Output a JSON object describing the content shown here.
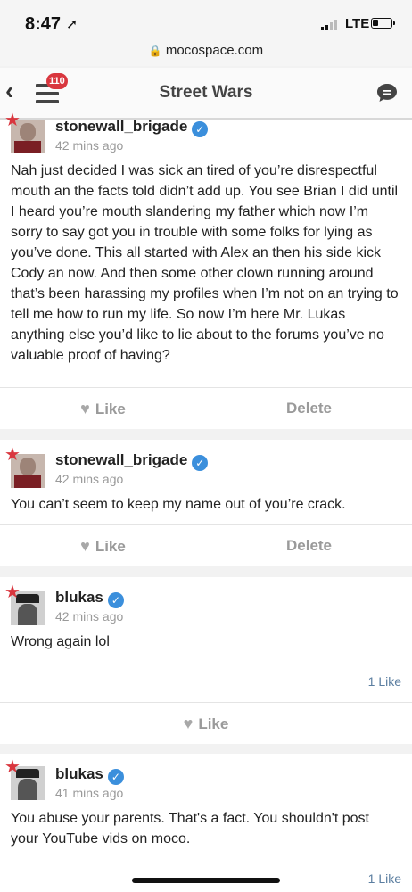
{
  "status": {
    "time": "8:47",
    "network": "LTE"
  },
  "browser": {
    "url": "mocospace.com"
  },
  "header": {
    "title": "Street Wars",
    "badge_count": "110"
  },
  "posts": [
    {
      "username": "stonewall_brigade",
      "time": "42 mins ago",
      "text": "Nah just decided I was sick an tired of you’re disrespectful mouth an the facts told didn’t add up. You see Brian I did until I heard you’re mouth slandering my father which now I’m sorry to say got you in trouble with some folks for lying as you’ve done. This all started with Alex an then his side kick Cody an now. And then some other clown running around that’s been harassing my profiles when I’m not on an trying to tell me how to run my life. So now I’m here Mr. Lukas anything else you’d like to lie about to the forums you’ve no valuable proof of having?",
      "like_label": "Like",
      "delete_label": "Delete"
    },
    {
      "username": "stonewall_brigade",
      "time": "42 mins ago",
      "text": "You can’t seem to keep my name out of you’re crack.",
      "like_label": "Like",
      "delete_label": "Delete"
    },
    {
      "username": "blukas",
      "time": "42 mins ago",
      "text": "Wrong again lol",
      "like_count": "1 Like",
      "like_label": "Like"
    },
    {
      "username": "blukas",
      "time": "41 mins ago",
      "text": "You abuse your parents. That's a fact. You shouldn't post your YouTube vids on moco.",
      "like_count": "1 Like"
    }
  ]
}
